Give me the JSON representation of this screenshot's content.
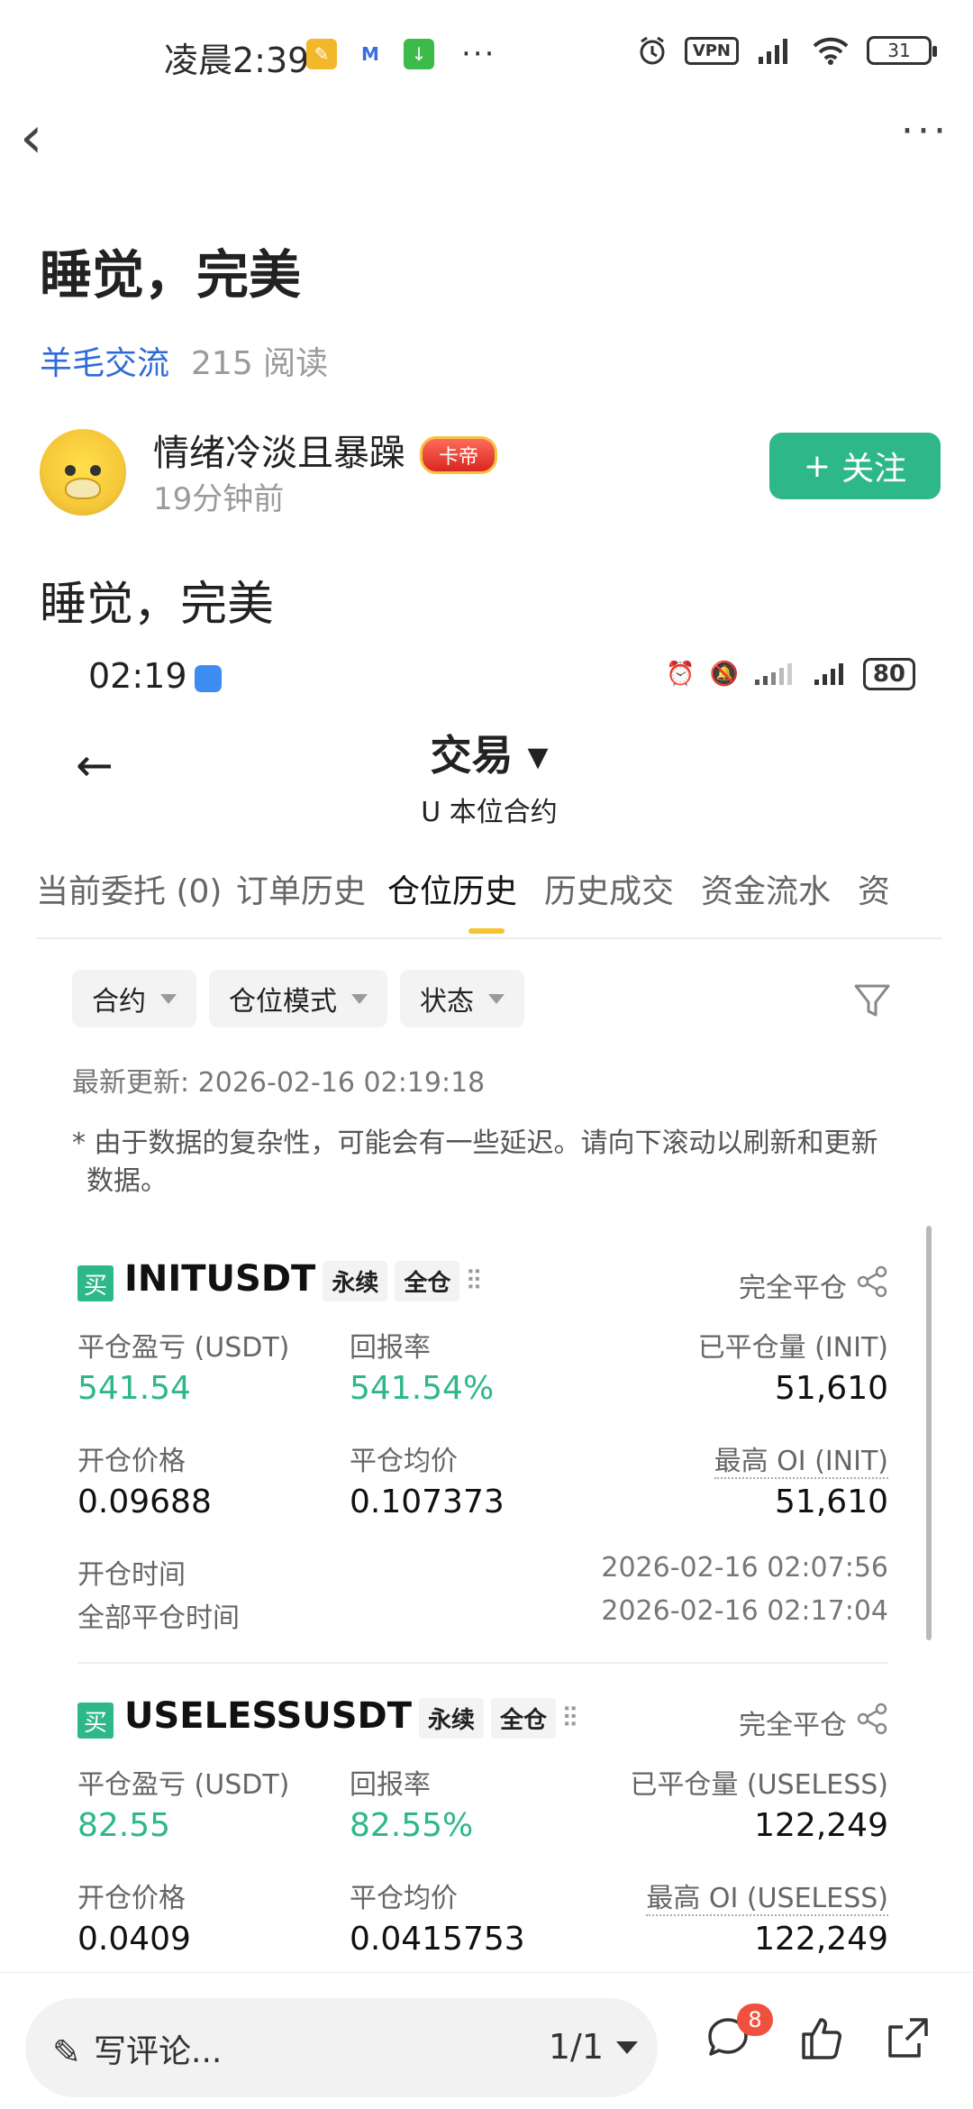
{
  "status_bar": {
    "time": "凌晨2:39",
    "vpn": "VPN",
    "battery": "31",
    "dots": "···"
  },
  "header": {
    "back": "‹",
    "more": "···"
  },
  "post": {
    "title": "睡觉，完美",
    "group": "羊毛交流",
    "reads": "215 阅读",
    "author": "情绪冷淡且暴躁",
    "author_badge": "卡帝",
    "time": "19分钟前",
    "follow_label": "关注",
    "body": "睡觉，完美"
  },
  "screenshot": {
    "time": "02:19",
    "battery": "80",
    "back": "←",
    "title": "交易 ▾",
    "subtitle": "U 本位合约",
    "tabs": [
      "当前委托 (0)",
      "订单历史",
      "仓位历史",
      "历史成交",
      "资金流水",
      "资"
    ],
    "active_tab": 2,
    "filters": [
      "合约",
      "仓位模式",
      "状态"
    ],
    "updated": "最新更新: 2026-02-16 02:19:18",
    "note": "* 由于数据的复杂性，可能会有一些延迟。请向下滚动以刷新和更新数据。",
    "cards": [
      {
        "side": "买",
        "symbol": "INITUSDT",
        "tags": [
          "永续",
          "全仓"
        ],
        "status": "完全平仓",
        "pnl_label": "平仓盈亏 (USDT)",
        "pnl": "541.54",
        "roi_label": "回报率",
        "roi": "541.54%",
        "closed_label": "已平仓量 (INIT)",
        "closed": "51,610",
        "open_price_label": "开仓价格",
        "open_price": "0.09688",
        "avg_close_label": "平仓均价",
        "avg_close": "0.107373",
        "max_oi_label": "最高 OI (INIT)",
        "max_oi": "51,610",
        "open_time_label": "开仓时间",
        "open_time": "2026-02-16 02:07:56",
        "close_time_label": "全部平仓时间",
        "close_time": "2026-02-16 02:17:04"
      },
      {
        "side": "买",
        "symbol": "USELESSUSDT",
        "tags": [
          "永续",
          "全仓"
        ],
        "status": "完全平仓",
        "pnl_label": "平仓盈亏 (USDT)",
        "pnl": "82.55",
        "roi_label": "回报率",
        "roi": "82.55%",
        "closed_label": "已平仓量 (USELESS)",
        "closed": "122,249",
        "open_price_label": "开仓价格",
        "open_price": "0.0409",
        "avg_close_label": "平仓均价",
        "avg_close": "0.0415753",
        "max_oi_label": "最高 OI (USELESS)",
        "max_oi": "122,249"
      }
    ]
  },
  "bottom_bar": {
    "comment_placeholder": "写评论...",
    "page": "1/1",
    "comment_count": "8"
  },
  "colors": {
    "accent_green": "#2eb88a",
    "link_blue": "#2f6bd8",
    "tab_yellow": "#f4c430",
    "badge_red": "#f0513f"
  }
}
